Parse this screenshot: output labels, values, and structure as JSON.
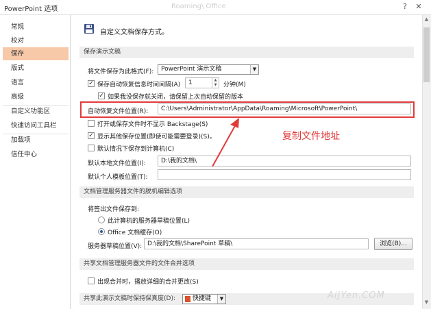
{
  "window": {
    "title": "PowerPoint 选项",
    "faded_title": "Roaming\\ Office",
    "help_glyph": "?",
    "close_glyph": "✕"
  },
  "sidebar": {
    "items": [
      {
        "label": "常规"
      },
      {
        "label": "校对"
      },
      {
        "label": "保存",
        "active": true
      },
      {
        "label": "版式"
      },
      {
        "label": "语言"
      },
      {
        "label": "高级"
      },
      {
        "label": "自定义功能区"
      },
      {
        "label": "快速访问工具栏"
      },
      {
        "label": "加载项"
      },
      {
        "label": "信任中心"
      }
    ]
  },
  "header": {
    "icon": "floppy-disk-icon",
    "title": "自定义文档保存方式。"
  },
  "save_presentations": {
    "heading": "保存演示文稿",
    "format_label": "将文件保存为此格式(F):",
    "format_value": "PowerPoint 演示文稿",
    "autorecover_label": "保存自动恢复信息时间间隔(A)",
    "autorecover_checked": true,
    "autorecover_minutes": "1",
    "minutes_label": "分钟(M)",
    "keep_last_label": "如果我没保存就关闭，请保留上次自动保留的版本",
    "keep_last_checked": true,
    "autorecover_location_label": "自动恢复文件位置(R):",
    "autorecover_location_value": "C:\\Users\\Administrator\\AppData\\Roaming\\Microsoft\\PowerPoint\\",
    "no_backstage_label": "打开或保存文件时不显示 Backstage(S)",
    "no_backstage_checked": false,
    "show_more_label": "显示其他保存位置(即使可能需要登录)(S)。",
    "show_more_checked": true,
    "default_computer_label": "默认情况下保存到计算机(C)",
    "default_computer_checked": false,
    "default_local_label": "默认本地文件位置(I):",
    "default_local_value": "D:\\我的文档\\",
    "template_label": "默认个人模板位置(T):",
    "template_value": ""
  },
  "offline_editing": {
    "heading": "文档管理服务器文件的脱机编辑选项",
    "checkout_label": "将签出文件保存到:",
    "server_drafts_label": "此计算机的服务器草稿位置(L)",
    "office_cache_label": "Office 文档缓存(O)",
    "selected": "office_cache",
    "drafts_location_label": "服务器草稿位置(V):",
    "drafts_location_value": "D:\\我的文档\\SharePoint 草稿\\",
    "browse_label": "浏览(B)..."
  },
  "merge": {
    "heading": "共享文档管理服务器文件的文件合并选项",
    "show_changes_label": "出现合并时，播放详细的合并更改(S)",
    "show_changes_checked": false
  },
  "fidelity": {
    "label": "共享此演示文稿时保持保真度(D):",
    "doc_value": "快捷键"
  },
  "annotation": {
    "text": "复制文件地址",
    "color": "#e23a3a"
  },
  "watermark": "AiJYen.COM"
}
